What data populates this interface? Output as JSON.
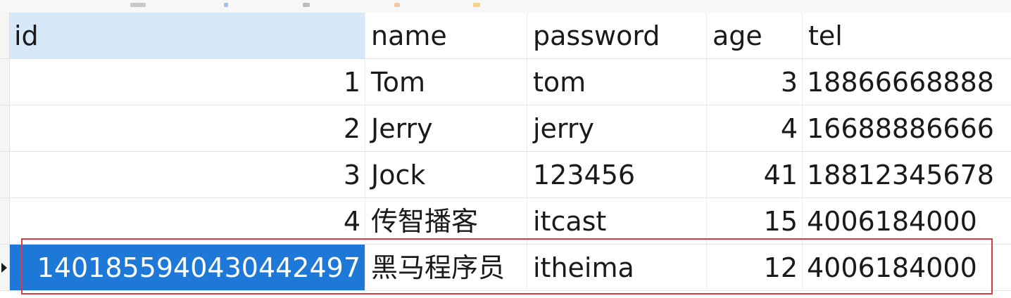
{
  "table": {
    "columns": [
      "id",
      "name",
      "password",
      "age",
      "tel"
    ],
    "rows": [
      {
        "id": "1",
        "name": "Tom",
        "password": "tom",
        "age": "3",
        "tel": "18866668888"
      },
      {
        "id": "2",
        "name": "Jerry",
        "password": "jerry",
        "age": "4",
        "tel": "16688886666"
      },
      {
        "id": "3",
        "name": "Jock",
        "password": "123456",
        "age": "41",
        "tel": "18812345678"
      },
      {
        "id": "4",
        "name": "传智播客",
        "password": "itcast",
        "age": "15",
        "tel": "4006184000"
      },
      {
        "id": "1401855940430442497",
        "name": "黑马程序员",
        "password": "itheima",
        "age": "12",
        "tel": "4006184000"
      }
    ],
    "selected_row": 4
  },
  "colors": {
    "selection": "#1e78d7",
    "header_highlight": "#d7e8f9",
    "annotation_box": "#e0383e"
  }
}
